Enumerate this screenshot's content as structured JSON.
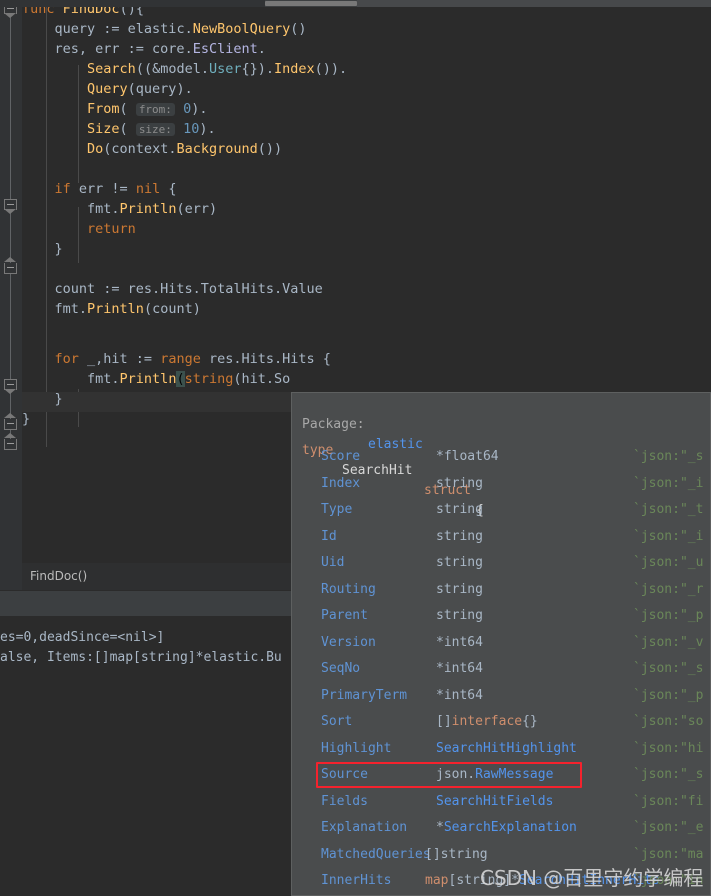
{
  "window": {
    "app": "GoLand",
    "scrollbar": {
      "orientation": "horizontal"
    }
  },
  "editor": {
    "language": "go",
    "caret_line_index": 17,
    "lines": [
      "func FindDoc(){",
      "    query := elastic.NewBoolQuery()",
      "    res, err := core.EsClient.",
      "        Search((&model.User{}).Index()).",
      "        Query(query).",
      "        From( from: 0).",
      "        Size( size: 10).",
      "        Do(context.Background())",
      "",
      "    if err != nil {",
      "        fmt.Println(err)",
      "        return",
      "    }",
      "",
      "    count := res.Hits.TotalHits.Value",
      "    fmt.Println(count)",
      "",
      "    for _,hit := range res.Hits.Hits {",
      "        fmt.Println(string(hit.So",
      "    }",
      "}"
    ],
    "inlay_hints": [
      {
        "label": "from:",
        "line": 5
      },
      {
        "label": "size:",
        "line": 6
      }
    ],
    "tokens": {
      "line0": {
        "kw": "func",
        "name": "FindDoc",
        "tail": "(){"
      },
      "line1": {
        "var": "query",
        "op": ":=",
        "pkg": "elastic",
        "call": "NewBoolQuery"
      },
      "line2": {
        "a": "res",
        "b": "err",
        "op": ":=",
        "pkg": "core",
        "member": "EsClient"
      },
      "line3": {
        "call": "Search",
        "pkg": "model",
        "type": "User",
        "method": "Index"
      },
      "line4": {
        "call": "Query",
        "arg": "query"
      },
      "line5": {
        "call": "From",
        "value": "0"
      },
      "line6": {
        "call": "Size",
        "value": "10"
      },
      "line7": {
        "call": "Do",
        "pkg": "context",
        "method": "Background"
      },
      "line9": {
        "kw": "if",
        "a": "err",
        "op": "!=",
        "b": "nil"
      },
      "line10": {
        "pkg": "fmt",
        "call": "Println",
        "arg": "err"
      },
      "line11": {
        "kw": "return"
      },
      "line14": {
        "var": "count",
        "expr": "res.Hits.TotalHits.Value"
      },
      "line15": {
        "pkg": "fmt",
        "call": "Println",
        "arg": "count"
      },
      "line17": {
        "kw": "for",
        "a": "_,hit",
        "op": ":=",
        "kw2": "range",
        "expr": "res.Hits.Hits"
      },
      "line18": {
        "pkg": "fmt",
        "call": "Println",
        "cast": "string",
        "arg": "hit.So"
      }
    }
  },
  "breadcrumb": {
    "path": "FindDoc()"
  },
  "console": {
    "lines": [
      "es=0,deadSince=<nil>]",
      "alse, Items:[]map[string]*elastic.Bu"
    ]
  },
  "popup": {
    "package_label": "Package:",
    "package_name": "elastic",
    "decl_keyword": "type",
    "decl_name": "SearchHit",
    "decl_kind": "struct",
    "decl_brace": "{",
    "highlighted_field": "Source",
    "fields": [
      {
        "name": "Score",
        "type": "*float64",
        "tag": "`json:\"_s"
      },
      {
        "name": "Index",
        "type": "string",
        "tag": "`json:\"_i"
      },
      {
        "name": "Type",
        "type": "string",
        "tag": "`json:\"_t"
      },
      {
        "name": "Id",
        "type": "string",
        "tag": "`json:\"_i"
      },
      {
        "name": "Uid",
        "type": "string",
        "tag": "`json:\"_u"
      },
      {
        "name": "Routing",
        "type": "string",
        "tag": "`json:\"_r"
      },
      {
        "name": "Parent",
        "type": "string",
        "tag": "`json:\"_p"
      },
      {
        "name": "Version",
        "type": "*int64",
        "tag": "`json:\"_v"
      },
      {
        "name": "SeqNo",
        "type": "*int64",
        "tag": "`json:\"_s"
      },
      {
        "name": "PrimaryTerm",
        "type": "*int64",
        "tag": "`json:\"_p"
      },
      {
        "name": "Sort",
        "type": "[]interface{}",
        "tag": "`json:\"so"
      },
      {
        "name": "Highlight",
        "type": "SearchHitHighlight",
        "tag": "`json:\"hi"
      },
      {
        "name": "Source",
        "type": "json.RawMessage",
        "tag": "`json:\"_s"
      },
      {
        "name": "Fields",
        "type": "SearchHitFields",
        "tag": "`json:\"fi"
      },
      {
        "name": "Explanation",
        "type": "*SearchExplanation",
        "tag": "`json:\"_e"
      },
      {
        "name": "MatchedQueries",
        "type": "[]string",
        "tag": "`json:\"ma"
      },
      {
        "name": "InnerHits",
        "type": "map[string]*SearchHitInnerHits",
        "tag": "`json:\"in"
      }
    ]
  },
  "watermark": {
    "text": "CSDN @百里守约学编程"
  },
  "colors": {
    "editor_bg": "#2b2b2b",
    "gutter_bg": "#313335",
    "popup_bg": "#4a4c4d",
    "highlight_border": "#f5222d",
    "keyword": "#cc7832",
    "function": "#ffc66d",
    "number": "#6897bb",
    "string_tag": "#6a8759",
    "field": "#5f93d4"
  }
}
